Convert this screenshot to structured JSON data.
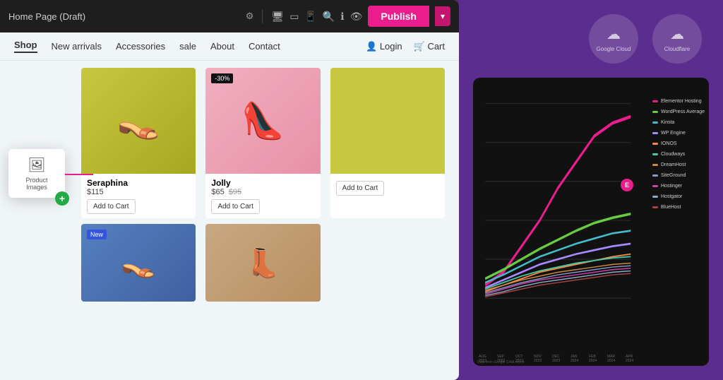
{
  "toolbar": {
    "title": "Home Page (Draft)",
    "settings_icon": "⚙",
    "devices": [
      "🖥",
      "💻",
      "📱"
    ],
    "right_icons": [
      "🔍",
      "ℹ",
      "👁"
    ],
    "publish_label": "Publish",
    "dropdown_icon": "▾"
  },
  "nav": {
    "links": [
      {
        "label": "Shop",
        "active": true
      },
      {
        "label": "New arrivals"
      },
      {
        "label": "Accessories"
      },
      {
        "label": "sale"
      },
      {
        "label": "About"
      },
      {
        "label": "Contact"
      }
    ],
    "right": [
      {
        "label": "Login",
        "icon": "👤"
      },
      {
        "label": "Cart",
        "icon": "🛒"
      }
    ]
  },
  "element_popup": {
    "label": "Product Images"
  },
  "products": [
    {
      "name": "Seraphina",
      "price": "$115",
      "price_original": "",
      "badge": "",
      "add_to_cart": "Add to Cart",
      "color": "yellow"
    },
    {
      "name": "Jolly",
      "price": "$65",
      "price_original": "$95",
      "badge": "-30%",
      "add_to_cart": "Add to Cart",
      "color": "pink"
    },
    {
      "name": "",
      "price": "",
      "price_original": "",
      "badge": "",
      "add_to_cart": "Add to Cart",
      "color": "yellow-plain"
    }
  ],
  "products_row2": [
    {
      "name": "",
      "badge": "New",
      "color": "blue"
    },
    {
      "name": "",
      "badge": "",
      "color": "beige"
    }
  ],
  "cloud_logos": [
    {
      "name": "Google Cloud",
      "icon": "☁"
    },
    {
      "name": "Cloudflare",
      "icon": "☁"
    }
  ],
  "chart": {
    "title": "",
    "badge": "E",
    "x_labels": [
      "AUG\n2023",
      "SEP\n2023",
      "OCT\n2023",
      "NOV\n2023",
      "DEC\n2023",
      "JAN\n2024",
      "FEB\n2024",
      "MAR\n2024",
      "APR\n2024"
    ],
    "legend": [
      {
        "color": "#e91e8c",
        "label": "Elementor Hosting"
      },
      {
        "color": "#66cc44",
        "label": "WordPress Average"
      },
      {
        "color": "#44bbcc",
        "label": "Kinsta"
      },
      {
        "color": "#aa88ff",
        "label": "WP Engine"
      },
      {
        "color": "#ff8844",
        "label": "IONOS"
      },
      {
        "color": "#44ccaa",
        "label": "Cloudways"
      },
      {
        "color": "#cc8844",
        "label": "DreamHost"
      },
      {
        "color": "#8899cc",
        "label": "SiteGround"
      },
      {
        "color": "#cc44aa",
        "label": "Hostinger"
      },
      {
        "color": "#88aacc",
        "label": "Hostgator"
      },
      {
        "color": "#aa4444",
        "label": "BlueHost"
      }
    ],
    "source": "Data from Google CAIA report"
  }
}
